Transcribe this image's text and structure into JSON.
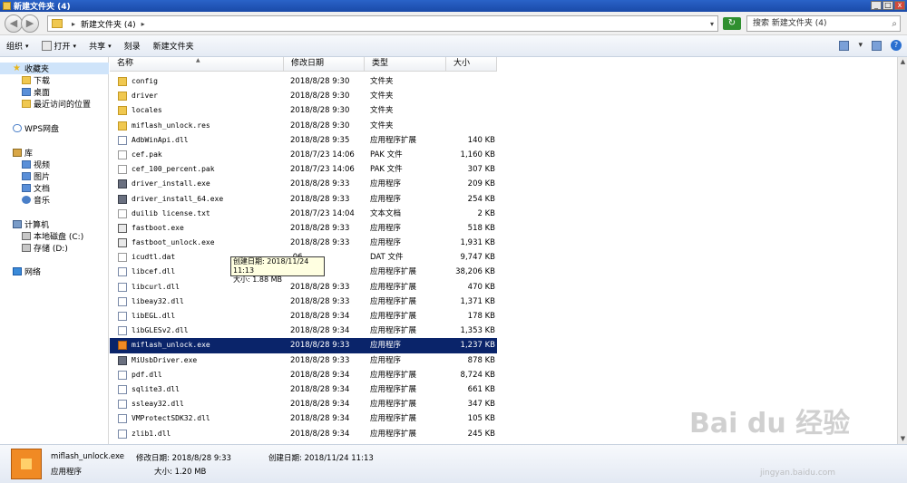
{
  "window": {
    "title": "新建文件夹 (4)",
    "min": "_",
    "max": "□",
    "close": "x"
  },
  "address": {
    "path": "新建文件夹 (4)",
    "separator": "▸",
    "dropdown": "▾",
    "back": "◀",
    "forward": "▶",
    "refresh": "↻"
  },
  "search": {
    "text": "搜索 新建文件夹 (4)",
    "icon": "⌕"
  },
  "toolbar": {
    "organize": "组织",
    "open": "打开",
    "share": "共享",
    "burn": "刻录",
    "new_folder": "新建文件夹",
    "caret": "▾",
    "help": "?",
    "view_caret": "▾"
  },
  "nav": {
    "favorites": "收藏夹",
    "downloads": "下载",
    "desktop": "桌面",
    "recent": "最近访问的位置",
    "wps": "WPS网盘",
    "library": "库",
    "video": "视频",
    "pictures": "图片",
    "documents": "文档",
    "music": "音乐",
    "computer": "计算机",
    "local_disk": "本地磁盘 (C:)",
    "storage": "存储 (D:)",
    "network": "网络",
    "star": "★"
  },
  "columns": {
    "name": "名称",
    "date": "修改日期",
    "type": "类型",
    "size": "大小",
    "sort_arrow": "▲"
  },
  "files": [
    {
      "name": "config",
      "date": "2018/8/28 9:30",
      "type": "文件夹",
      "size": "",
      "icon": "folder"
    },
    {
      "name": "driver",
      "date": "2018/8/28 9:30",
      "type": "文件夹",
      "size": "",
      "icon": "folder"
    },
    {
      "name": "locales",
      "date": "2018/8/28 9:30",
      "type": "文件夹",
      "size": "",
      "icon": "folder"
    },
    {
      "name": "miflash_unlock.res",
      "date": "2018/8/28 9:30",
      "type": "文件夹",
      "size": "",
      "icon": "folder"
    },
    {
      "name": "AdbWinApi.dll",
      "date": "2018/8/28 9:35",
      "type": "应用程序扩展",
      "size": "140 KB",
      "icon": "dll"
    },
    {
      "name": "cef.pak",
      "date": "2018/7/23 14:06",
      "type": "PAK 文件",
      "size": "1,160 KB",
      "icon": "doc"
    },
    {
      "name": "cef_100_percent.pak",
      "date": "2018/7/23 14:06",
      "type": "PAK 文件",
      "size": "307 KB",
      "icon": "doc"
    },
    {
      "name": "driver_install.exe",
      "date": "2018/8/28 9:33",
      "type": "应用程序",
      "size": "209 KB",
      "icon": "exe"
    },
    {
      "name": "driver_install_64.exe",
      "date": "2018/8/28 9:33",
      "type": "应用程序",
      "size": "254 KB",
      "icon": "exe"
    },
    {
      "name": "duilib license.txt",
      "date": "2018/7/23 14:04",
      "type": "文本文档",
      "size": "2 KB",
      "icon": "doc"
    },
    {
      "name": "fastboot.exe",
      "date": "2018/8/28 9:33",
      "type": "应用程序",
      "size": "518 KB",
      "icon": "app"
    },
    {
      "name": "fastboot_unlock.exe",
      "date": "2018/8/28 9:33",
      "type": "应用程序",
      "size": "1,931 KB",
      "icon": "app"
    },
    {
      "name": "icudtl.dat",
      "date": ".06",
      "type": "DAT 文件",
      "size": "9,747 KB",
      "icon": "doc"
    },
    {
      "name": "libcef.dll",
      "date": "34",
      "type": "应用程序扩展",
      "size": "38,206 KB",
      "icon": "dll"
    },
    {
      "name": "libcurl.dll",
      "date": "2018/8/28 9:33",
      "type": "应用程序扩展",
      "size": "470 KB",
      "icon": "dll"
    },
    {
      "name": "libeay32.dll",
      "date": "2018/8/28 9:33",
      "type": "应用程序扩展",
      "size": "1,371 KB",
      "icon": "dll"
    },
    {
      "name": "libEGL.dll",
      "date": "2018/8/28 9:34",
      "type": "应用程序扩展",
      "size": "178 KB",
      "icon": "dll"
    },
    {
      "name": "libGLESv2.dll",
      "date": "2018/8/28 9:34",
      "type": "应用程序扩展",
      "size": "1,353 KB",
      "icon": "dll"
    },
    {
      "name": "miflash_unlock.exe",
      "date": "2018/8/28 9:33",
      "type": "应用程序",
      "size": "1,237 KB",
      "icon": "orange"
    },
    {
      "name": "MiUsbDriver.exe",
      "date": "2018/8/28 9:33",
      "type": "应用程序",
      "size": "878 KB",
      "icon": "exe"
    },
    {
      "name": "pdf.dll",
      "date": "2018/8/28 9:34",
      "type": "应用程序扩展",
      "size": "8,724 KB",
      "icon": "dll"
    },
    {
      "name": "sqlite3.dll",
      "date": "2018/8/28 9:34",
      "type": "应用程序扩展",
      "size": "661 KB",
      "icon": "dll"
    },
    {
      "name": "ssleay32.dll",
      "date": "2018/8/28 9:34",
      "type": "应用程序扩展",
      "size": "347 KB",
      "icon": "dll"
    },
    {
      "name": "VMProtectSDK32.dll",
      "date": "2018/8/28 9:34",
      "type": "应用程序扩展",
      "size": "105 KB",
      "icon": "dll"
    },
    {
      "name": "zlib1.dll",
      "date": "2018/8/28 9:34",
      "type": "应用程序扩展",
      "size": "245 KB",
      "icon": "dll"
    }
  ],
  "selected_index": 18,
  "tooltip": {
    "line1": "创建日期: 2018/11/24 11:13",
    "line2": "大小: 1.88 MB"
  },
  "details": {
    "filename": "miflash_unlock.exe",
    "modified": "修改日期: 2018/8/28 9:33",
    "created": "创建日期: 2018/11/24 11:13",
    "type": "应用程序",
    "size": "大小: 1.20 MB"
  },
  "watermark": {
    "logo": "Bai du 经验",
    "url": "jingyan.baidu.com"
  }
}
